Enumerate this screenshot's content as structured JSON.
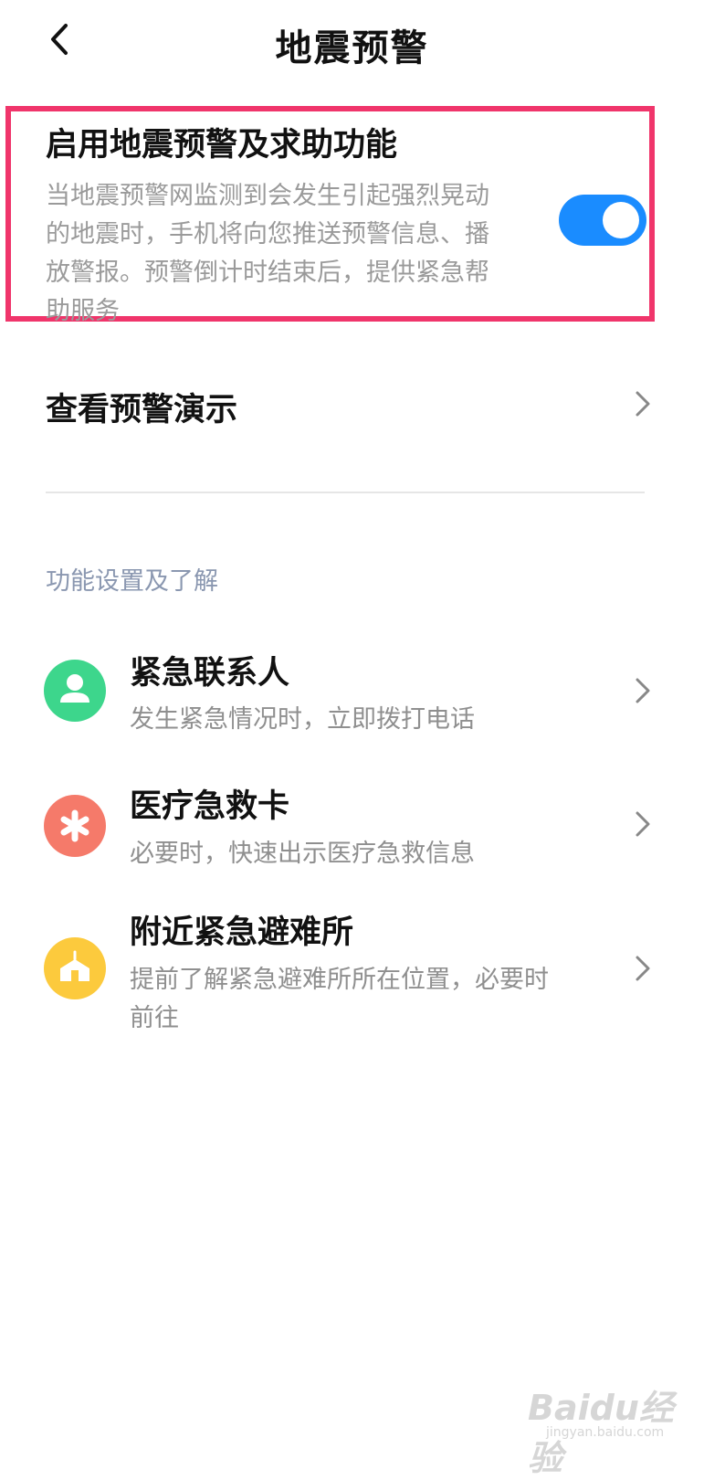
{
  "header": {
    "title": "地震预警"
  },
  "main_toggle": {
    "title": "启用地震预警及求助功能",
    "description": "当地震预警网监测到会发生引起强烈晃动的地震时，手机将向您推送预警信息、播放警报。预警倒计时结束后，提供紧急帮助服务",
    "enabled": true,
    "color": "#1a8cff"
  },
  "demo_row": {
    "label": "查看预警演示"
  },
  "section": {
    "header": "功能设置及了解"
  },
  "items": [
    {
      "title": "紧急联系人",
      "description": "发生紧急情况时，立即拨打电话",
      "icon": "person-icon",
      "color": "#3dd68c"
    },
    {
      "title": "医疗急救卡",
      "description": "必要时，快速出示医疗急救信息",
      "icon": "asterisk-icon",
      "color": "#f57a6a"
    },
    {
      "title": "附近紧急避难所",
      "description": "提前了解紧急避难所所在位置，必要时前往",
      "icon": "shelter-icon",
      "color": "#fcca3d"
    }
  ],
  "watermark": {
    "main": "Baidu经验",
    "sub": "jingyan.baidu.com"
  }
}
